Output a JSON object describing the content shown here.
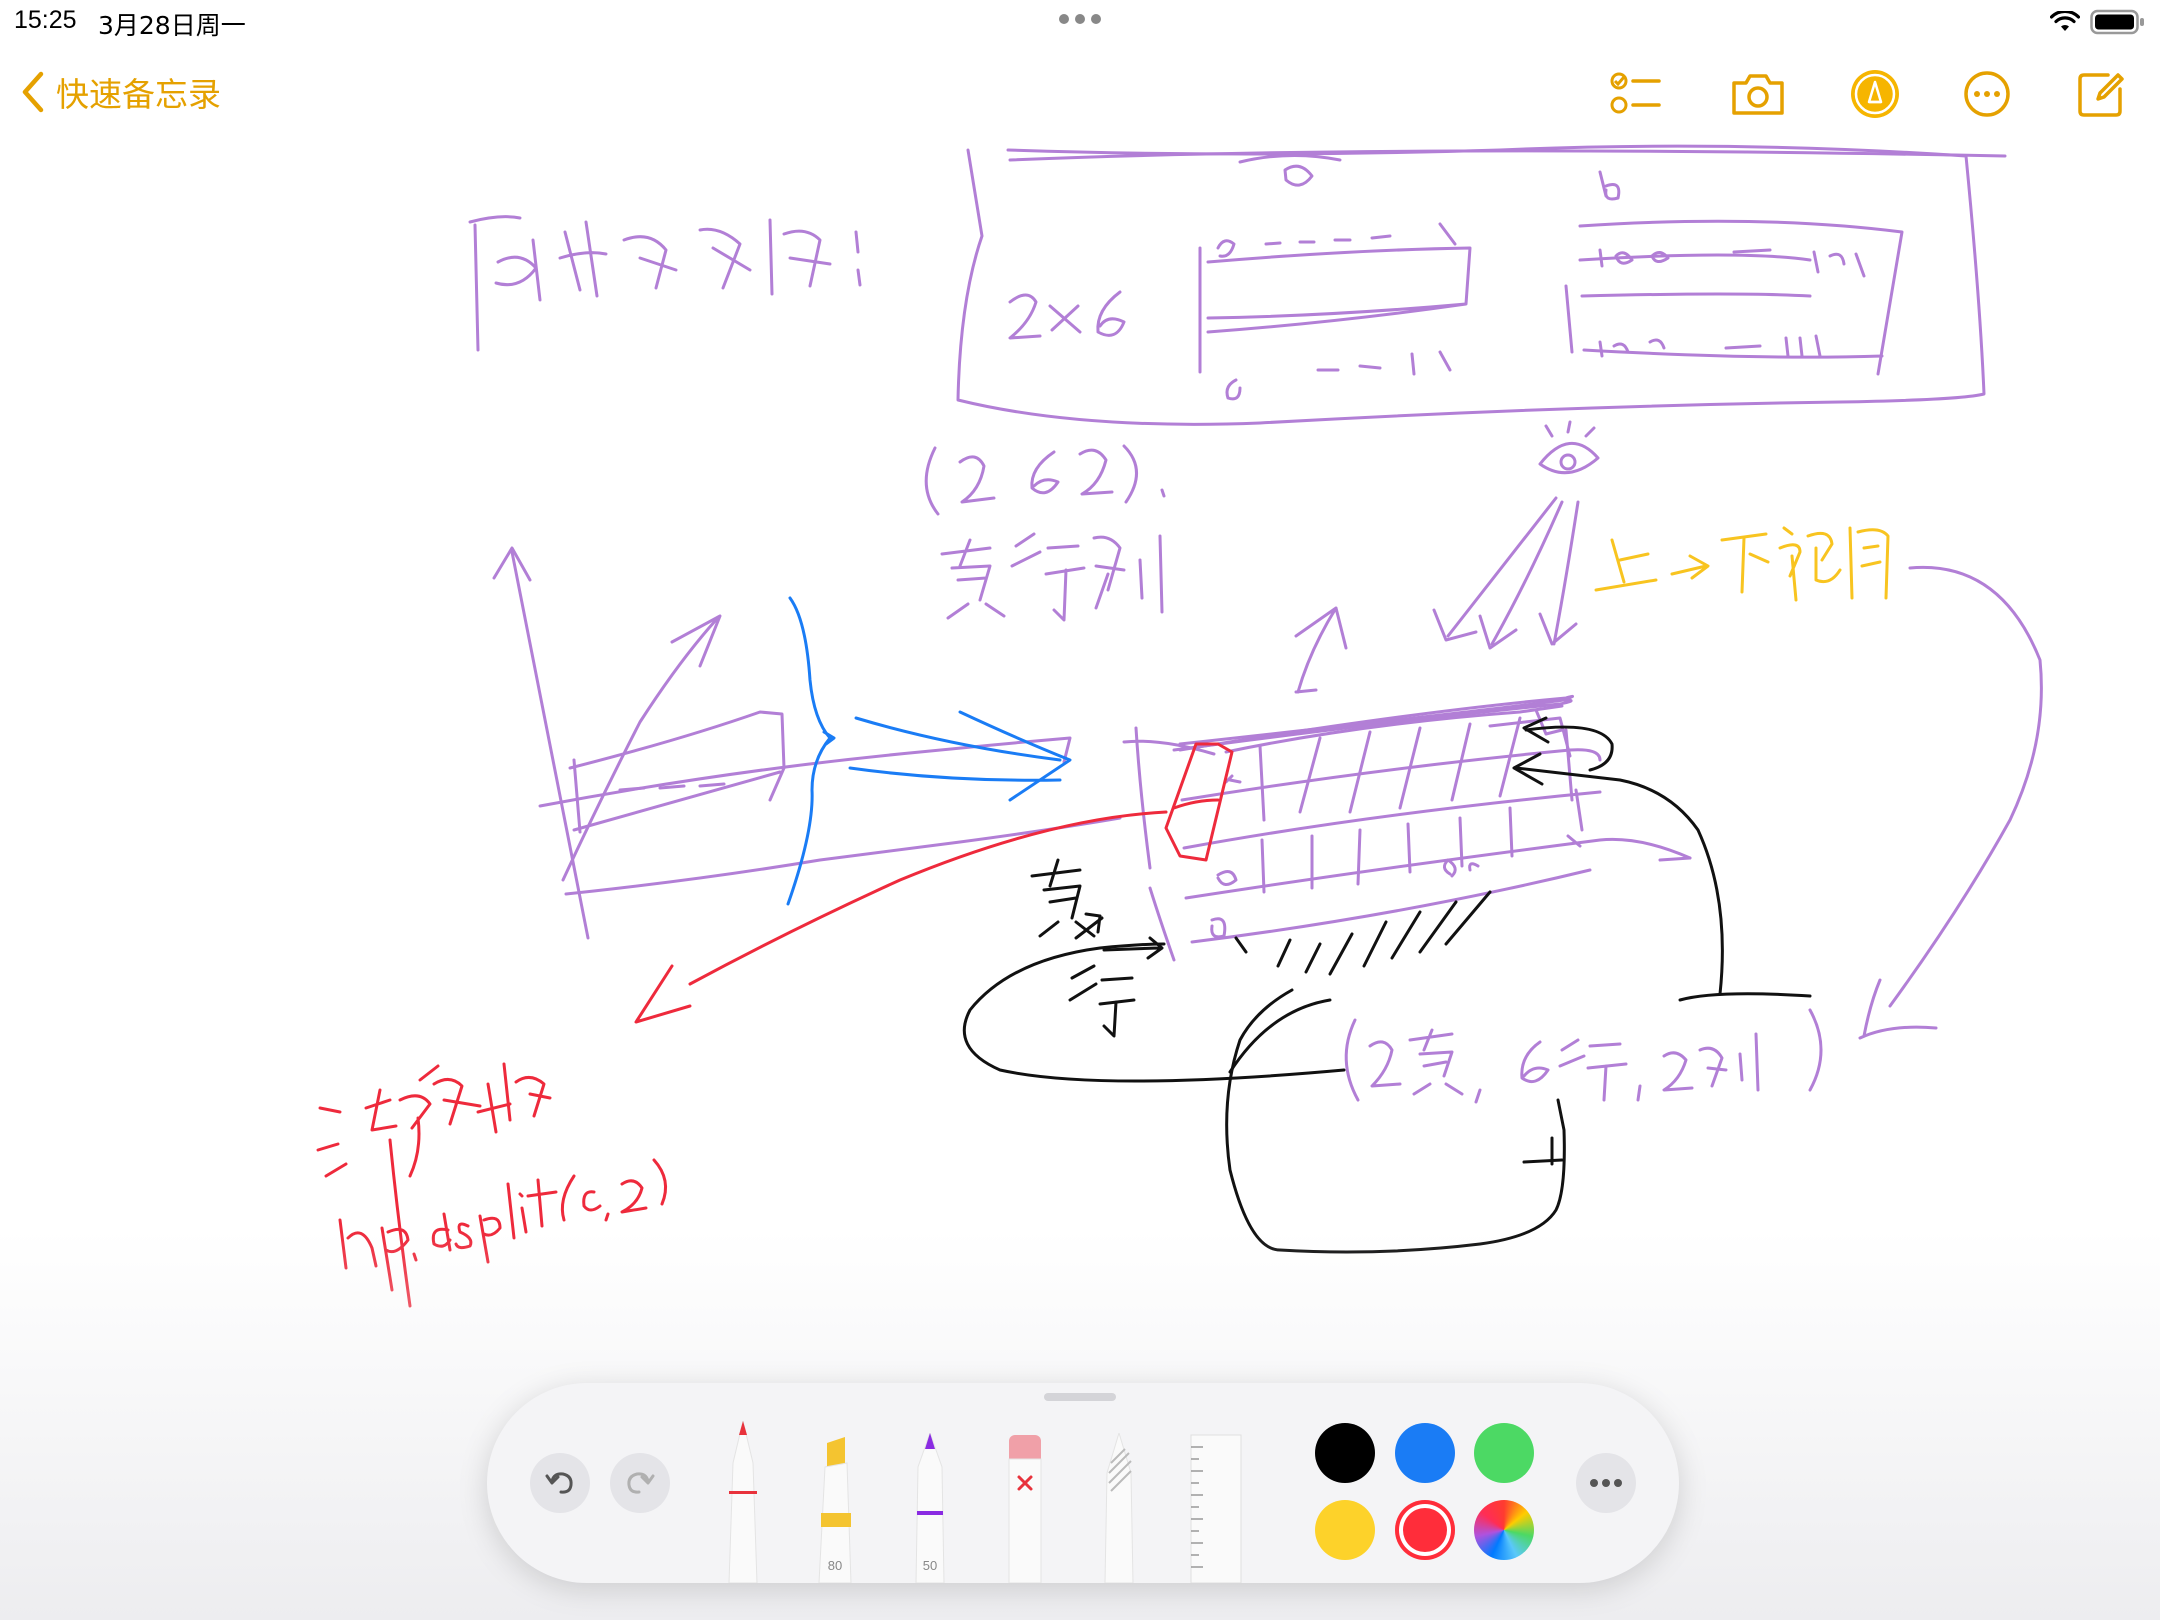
{
  "status": {
    "time": "15:25",
    "date": "3月28日周一"
  },
  "nav": {
    "back_label": "快速备忘录",
    "accent": "#e5a100"
  },
  "tools": {
    "highlighter_value": "80",
    "pencil_value": "50",
    "pen_color": "#e8323c",
    "highlighter_color": "#f4c430",
    "pencil_color": "#8a2be2"
  },
  "colors": {
    "swatches": [
      "#000000",
      "#1a7cf5",
      "#4cd964",
      "#fdd22a",
      "#ff2d3a",
      "color-wheel"
    ],
    "selected": "#ff2d3a"
  },
  "ink": {
    "purple": "#b27fd6",
    "blue": "#1a7cf5",
    "red": "#ee2a3c",
    "yellow": "#f8c420",
    "black": "#111111"
  }
}
